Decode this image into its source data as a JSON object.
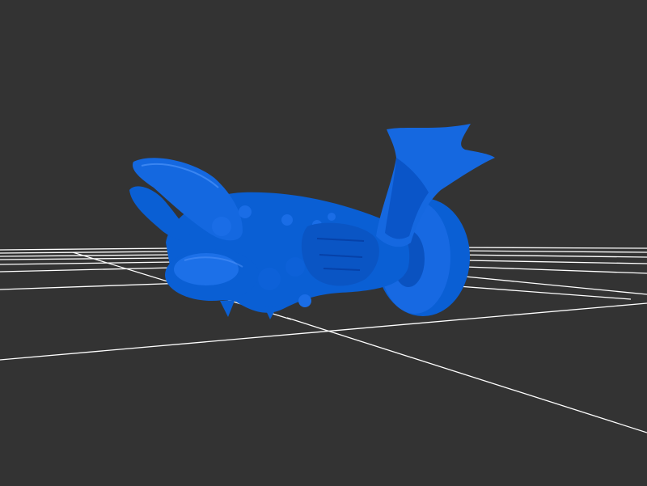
{
  "viewport": {
    "background_color": "#333333",
    "grid": {
      "visible": true,
      "color": "#ffffff"
    },
    "model": {
      "description_icon": "3d-model-icon",
      "fill_color": "#0a5fd4",
      "shade_dark": "#0641a8",
      "shade_light": "#2a7af0",
      "highlight": "#5a9cff"
    }
  }
}
